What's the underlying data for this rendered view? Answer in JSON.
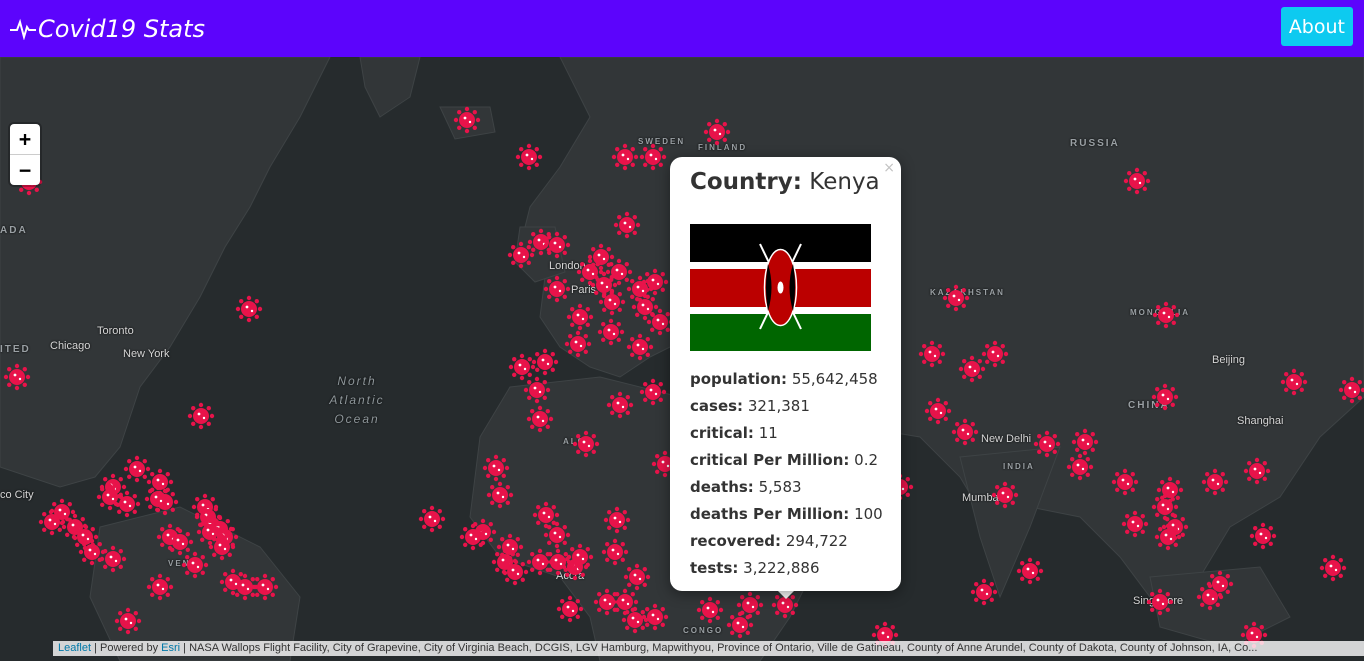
{
  "header": {
    "brand": "Covid19 Stats",
    "about_label": "About"
  },
  "map": {
    "zoom_in": "+",
    "zoom_out": "−",
    "labels": {
      "toronto": "Toronto",
      "chicago": "Chicago",
      "newyork": "New York",
      "ocean": "North Atlantic Ocean",
      "russia": "RUSSIA",
      "sweden": "SWEDEN",
      "finland": "FINLAND",
      "london": "London",
      "paris": "Paris",
      "kazakhstan": "KAZAKHSTAN",
      "mongolia": "MONGOLIA",
      "beijing": "Beijing",
      "china": "CHINA",
      "shanghai": "Shanghai",
      "newdelhi": "New Delhi",
      "india": "INDIA",
      "mumbai": "Mumbai",
      "canada": "ADA",
      "unitedstates": "ITED",
      "mexicocity": "co City",
      "algeria": "ALGE",
      "venezuela": "VENE",
      "accra": "Accra",
      "congo": "CONGO",
      "singapore": "Singapore"
    },
    "attribution": {
      "leaflet": "Leaflet",
      "powered": " | Powered by ",
      "esri": "Esri",
      "sources": " | NASA Wallops Flight Facility, City of Grapevine, City of Virginia Beach, DCGIS, LGV Hamburg, Mapwithyou, Province of Ontario, Ville de Gatineau, County of Anne Arundel, County of Dakota, County of Johnson, IA, Co..."
    }
  },
  "popup": {
    "close": "×",
    "country_label": "Country:",
    "country": "Kenya",
    "stats": [
      {
        "label": "population:",
        "value": "55,642,458"
      },
      {
        "label": "cases:",
        "value": "321,381"
      },
      {
        "label": "critical:",
        "value": "11"
      },
      {
        "label": "critical Per Million:",
        "value": "0.2"
      },
      {
        "label": "deaths:",
        "value": "5,583"
      },
      {
        "label": "deaths Per Million:",
        "value": "100"
      },
      {
        "label": "recovered:",
        "value": "294,722"
      },
      {
        "label": "tests:",
        "value": "3,222,886"
      }
    ]
  },
  "colors": {
    "navbar": "#5c04fc",
    "about": "#0dcaf0",
    "marker": "#e8134a"
  }
}
